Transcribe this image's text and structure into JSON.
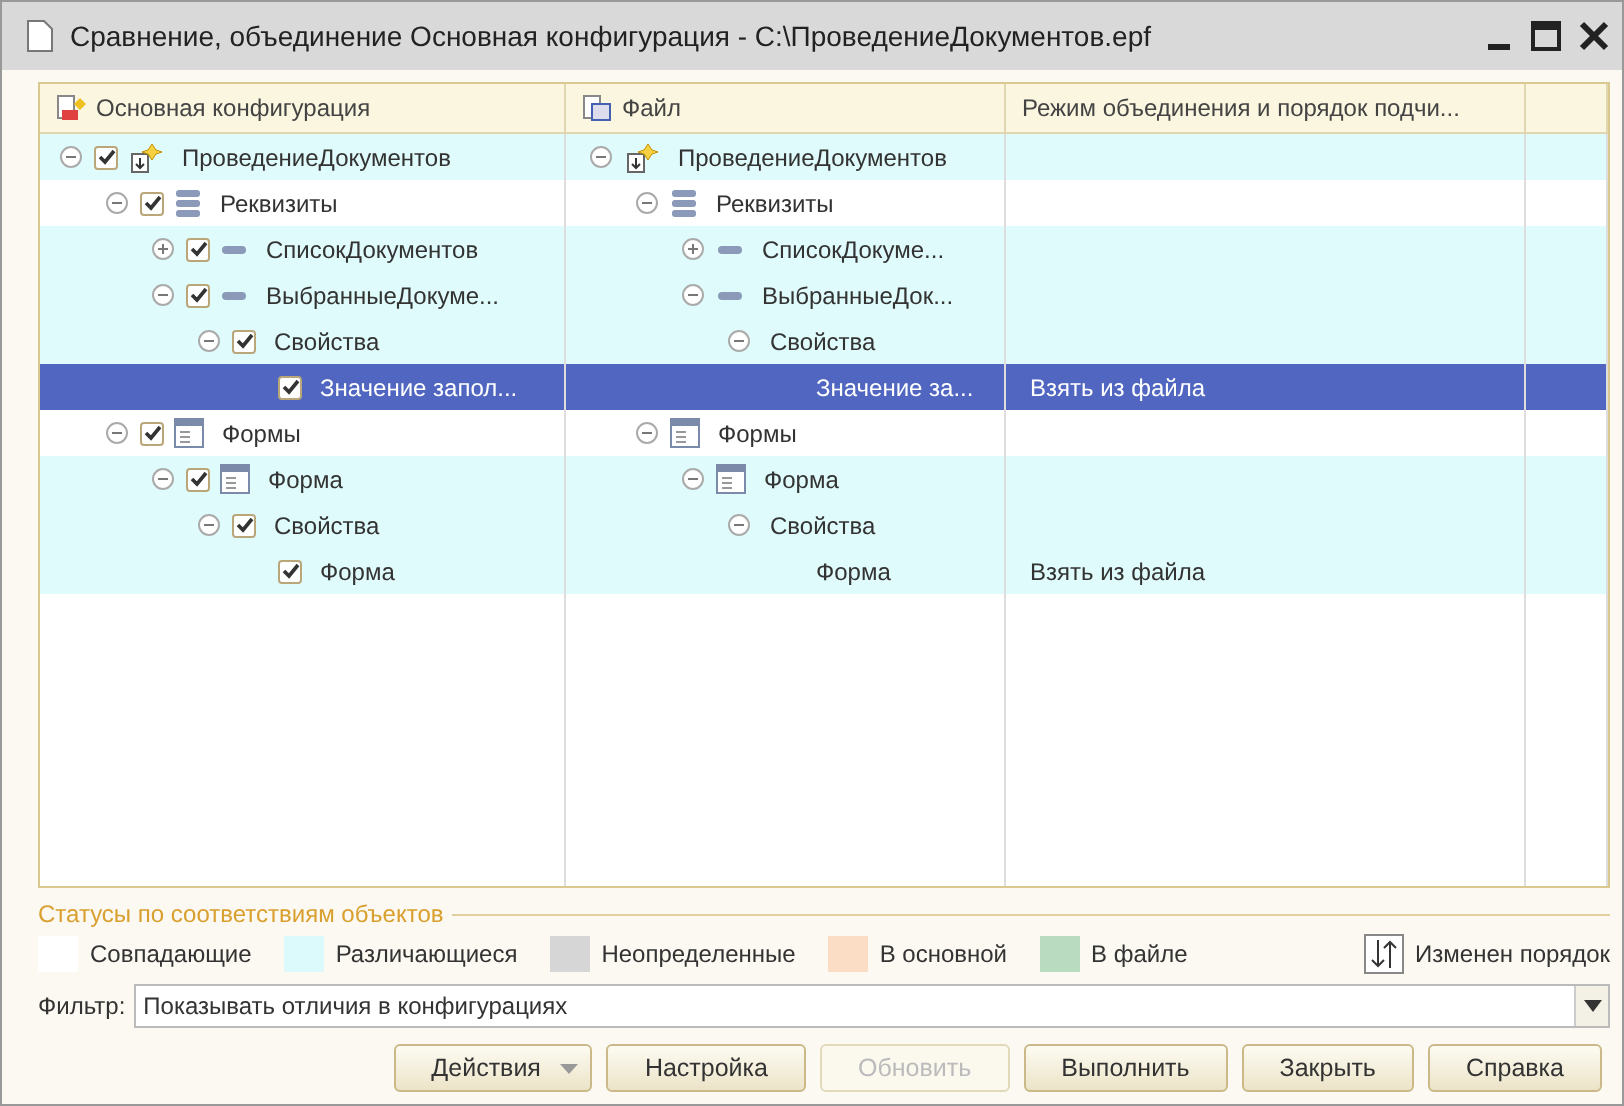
{
  "window": {
    "title": "Сравнение, объединение Основная конфигурация - C:\\ПроведениеДокументов.epf"
  },
  "table": {
    "columns": [
      "Основная конфигурация",
      "Файл",
      "Режим объединения и порядок подчи..."
    ],
    "tree": [
      {
        "left": "ПроведениеДокументов",
        "right": "ПроведениеДокументов",
        "kind": "config",
        "checked": true,
        "expanded": true,
        "color": "#e0fbfb",
        "selected": false,
        "children": [
          {
            "left": "Реквизиты",
            "right": "Реквизиты",
            "kind": "attributes",
            "checked": true,
            "expanded": true,
            "color": "#ffffff",
            "selected": false,
            "children": [
              {
                "left": "СписокДокументов",
                "right": "СписокДокуме...",
                "kind": "attribute",
                "checked": true,
                "expanded": false,
                "color": "#e0fbfb",
                "selected": false
              },
              {
                "left": "ВыбранныеДокуме...",
                "right": "ВыбранныеДок...",
                "kind": "attribute",
                "checked": true,
                "expanded": true,
                "color": "#e0fbfb",
                "selected": false,
                "children": [
                  {
                    "left": "Свойства",
                    "right": "Свойства",
                    "checked": true,
                    "expanded": true,
                    "color": "#e0fbfb",
                    "selected": false,
                    "children": [
                      {
                        "left": "Значение запол...",
                        "right": "Значение за...",
                        "mode": "Взять из файла",
                        "checked": true,
                        "selected": true
                      }
                    ]
                  }
                ]
              }
            ]
          },
          {
            "left": "Формы",
            "right": "Формы",
            "kind": "form",
            "checked": true,
            "expanded": true,
            "color": "#ffffff",
            "selected": false,
            "children": [
              {
                "left": "Форма",
                "right": "Форма",
                "kind": "form",
                "checked": true,
                "expanded": true,
                "color": "#e0fbfb",
                "selected": false,
                "children": [
                  {
                    "left": "Свойства",
                    "right": "Свойства",
                    "checked": true,
                    "expanded": true,
                    "color": "#e0fbfb",
                    "selected": false,
                    "children": [
                      {
                        "left": "Форма",
                        "right": "Форма",
                        "mode": "Взять из файла",
                        "checked": true,
                        "color": "#e0fbfb",
                        "selected": false
                      }
                    ]
                  }
                ]
              }
            ]
          }
        ]
      }
    ]
  },
  "legend": {
    "title": "Статусы по соответствиям объектов",
    "items": [
      {
        "label": "Совпадающие",
        "color": "#ffffff"
      },
      {
        "label": "Различающиеся",
        "color": "#dcfafc"
      },
      {
        "label": "Неопределенные",
        "color": "#d6d6d6"
      },
      {
        "label": "В основной",
        "color": "#fbdcc4"
      },
      {
        "label": "В файле",
        "color": "#b9dcc0"
      }
    ],
    "order_label": "Изменен порядок"
  },
  "filter": {
    "label": "Фильтр:",
    "value": "Показывать отличия в конфигурациях"
  },
  "buttons": [
    {
      "label": "Действия",
      "kind": "dropdown",
      "disabled": false
    },
    {
      "label": "Настройка",
      "kind": "plain",
      "disabled": false
    },
    {
      "label": "Обновить",
      "kind": "plain",
      "disabled": true
    },
    {
      "label": "Выполнить",
      "kind": "plain",
      "disabled": false
    },
    {
      "label": "Закрыть",
      "kind": "plain",
      "disabled": false
    },
    {
      "label": "Справка",
      "kind": "plain",
      "disabled": false
    }
  ]
}
